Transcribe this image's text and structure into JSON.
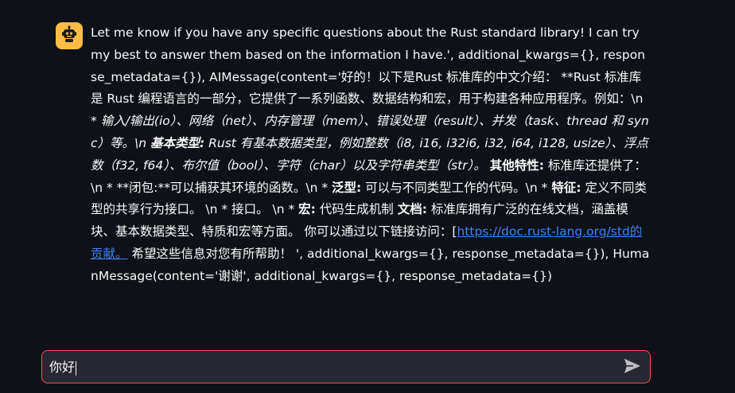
{
  "chat": {
    "assistant_message": {
      "avatar_icon": "robot-icon",
      "segments": [
        {
          "t": "Let me know if you have any specific questions about the Rust standard library! I can try my best to answer them based on the information I have.', additional_kwargs={}, response_metadata={}), AIMessage(content='好的！以下是Rust 标准库的中文介绍： **Rust 标准库是 Rust 编程语言的一部分，它提供了一系列函数、数据结构和宏，用于构建各种应用程序。例如：\\n * ",
          "s": "normal"
        },
        {
          "t": "输入/输出(io）、网络（net）、内存管理（mem）、错误处理（result）、并发（task、thread 和 sync）等。\\n ",
          "s": "italic"
        },
        {
          "t": "基本类型:",
          "s": "bold-italic"
        },
        {
          "t": " Rust 有基本数据类型，例如整数（i8, i16, i32i6, i32, i64, i128, usize）、浮点数（f32, f64）、布尔值（bool）、字符（char）以及字符串类型（str）。",
          "s": "italic"
        },
        {
          "t": " ",
          "s": "normal"
        },
        {
          "t": "其他特性:",
          "s": "bold"
        },
        {
          "t": " 标准库还提供了：\\n * **闭包:**可以捕获其环境的函数。\\n * ",
          "s": "normal"
        },
        {
          "t": "泛型:",
          "s": "bold"
        },
        {
          "t": " 可以与不同类型工作的代码。\\n * ",
          "s": "normal"
        },
        {
          "t": "特征:",
          "s": "bold"
        },
        {
          "t": " 定义不同类型的共享行为接口。 \\n * 接口。 \\n * ",
          "s": "normal"
        },
        {
          "t": "宏:",
          "s": "bold"
        },
        {
          "t": " 代码生成机制 ",
          "s": "normal"
        },
        {
          "t": "文档:",
          "s": "bold"
        },
        {
          "t": " 标准库拥有广泛的在线文档，涵盖模块、基本数据类型、特质和宏等方面。 你可以通过以下链接访问：[",
          "s": "normal"
        },
        {
          "t": "https://doc.rust-lang.org/std的贡献。",
          "s": "link"
        },
        {
          "t": " 希望这些信息对您有所帮助！ ', additional_kwargs={}, response_metadata={}), HumanMessage(content='谢谢', additional_kwargs={}, response_metadata={})",
          "s": "normal"
        }
      ]
    }
  },
  "input": {
    "value": "你好",
    "send_icon": "send-icon"
  },
  "colors": {
    "background": "#0e1117",
    "avatar": "#ffbd45",
    "input_border": "#ff4b4b",
    "input_bg": "#262730",
    "link": "#3b82f6"
  }
}
